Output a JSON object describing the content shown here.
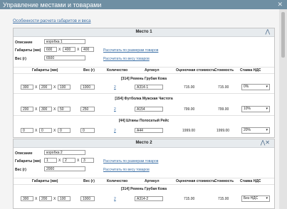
{
  "window": {
    "title": "Управление местами и товарами",
    "close_label": "✕"
  },
  "top_link": "Особенности расчета габаритов и веса",
  "labels": {
    "description": "Описание",
    "dims": "Габариты (мм)",
    "weight": "Вес (г)",
    "calc_dims": "Рассчитать по размерам товаров",
    "calc_weight": "Рассчитать по весу товаров"
  },
  "columns": [
    "Габариты (мм)",
    "Вес (г)",
    "Количество",
    "Артикул",
    "Оценочная стоимость",
    "Стоимость",
    "Ставка НДС"
  ],
  "places": [
    {
      "title": "Место 1",
      "control": "⋀",
      "description": "коробка 1",
      "dims": [
        "600",
        "400",
        "400"
      ],
      "weight": "6500",
      "products": [
        {
          "name": "[314] Ремень Грубая Кожа",
          "dims": [
            "300",
            "200",
            "100"
          ],
          "weight": "1000",
          "qty": "2",
          "article": "A314-1",
          "estimated": "715.00",
          "price": "715.00",
          "vat": "0%"
        },
        {
          "name": "[154] Футболка Мужская Чистота",
          "dims": [
            "200",
            "300",
            "50"
          ],
          "weight": "250",
          "qty": "2",
          "article": "A154",
          "estimated": "799.00",
          "price": "799.00",
          "vat": "10%"
        },
        {
          "name": "[44] Штаны Полосатый Рейс",
          "dims": [
            "0",
            "0",
            "0"
          ],
          "weight": "0",
          "qty": "2",
          "article": "A44",
          "estimated": "1999.00",
          "price": "1999.00",
          "vat": "20%"
        }
      ]
    },
    {
      "title": "Место 2",
      "control": "⋀✕",
      "description": "коробка 2",
      "dims": [
        "1",
        "2",
        "3"
      ],
      "weight": "2000",
      "products": [
        {
          "name": "[314] Ремень Грубая Кожа",
          "dims": [
            "300",
            "200",
            "100"
          ],
          "weight": "1000",
          "qty": "2",
          "article": "A314-2",
          "estimated": "715.00",
          "price": "715.00",
          "vat": "Без НДС"
        }
      ]
    }
  ],
  "colors": {
    "titlebar": "#6f8fa3",
    "link": "#3a6ea5",
    "header_bg": "#e7ebee"
  }
}
